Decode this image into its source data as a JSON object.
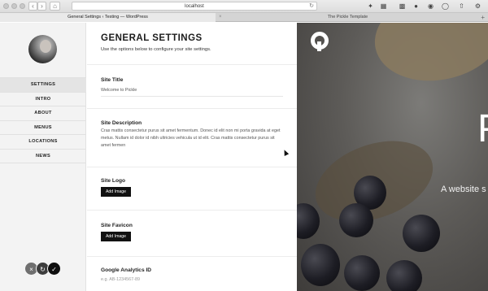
{
  "browser": {
    "url": "localhost",
    "tabs": [
      {
        "title": "General Settings ‹ Testing — WordPress",
        "active": true
      },
      {
        "title": "The Pickle Template",
        "active": false
      }
    ],
    "icons": [
      "back-icon",
      "forward-icon",
      "home-icon",
      "reload-icon",
      "wrench-icon",
      "share-icon",
      "bookmark-icon",
      "extension-icon",
      "settings-icon"
    ]
  },
  "sidebar": {
    "menu": [
      {
        "label": "SETTINGS",
        "active": true
      },
      {
        "label": "INTRO",
        "active": false
      },
      {
        "label": "ABOUT",
        "active": false
      },
      {
        "label": "MENUS",
        "active": false
      },
      {
        "label": "LOCATIONS",
        "active": false
      },
      {
        "label": "NEWS",
        "active": false
      }
    ],
    "actions": [
      "close-icon",
      "undo-icon",
      "check-icon"
    ]
  },
  "panel": {
    "title": "GENERAL SETTINGS",
    "intro": "Use the options below to configure your site settings.",
    "site_title": {
      "label": "Site Title",
      "value": "Welcome to Pickle"
    },
    "site_description": {
      "label": "Site Description",
      "value": "Cras mattis consectetur purus sit amet fermentum. Donec id elit non mi porta gravida at eget metus. Nullam id dolor id nibh ultricies vehicula ut id elit. Cras mattis consectetur purus sit amet fermen"
    },
    "site_logo": {
      "label": "Site Logo",
      "button": "Add Image"
    },
    "site_favicon": {
      "label": "Site Favicon",
      "button": "Add Image"
    },
    "analytics": {
      "label": "Google Analytics ID",
      "placeholder": "e.g. AB-1234567-89"
    }
  },
  "preview": {
    "hero_letter": "P",
    "tagline": "A website s"
  }
}
